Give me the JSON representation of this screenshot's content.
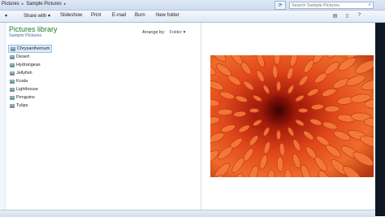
{
  "address": {
    "crumbs": [
      "Pictures",
      "Sample Pictures"
    ],
    "search_placeholder": "Search Sample Pictures"
  },
  "toolbar": {
    "items": [
      "Slideshow",
      "Print",
      "E-mail",
      "Burn",
      "New folder"
    ],
    "share": "Share with"
  },
  "library": {
    "title": "Pictures library",
    "subtitle": "Sample Pictures",
    "arrange_label": "Arrange by:",
    "arrange_value": "Folder"
  },
  "files": [
    "Chrysanthemum",
    "Desert",
    "Hydrangeas",
    "Jellyfish",
    "Koala",
    "Lighthouse",
    "Penguins",
    "Tulips"
  ],
  "colors": {
    "library_title": "#1c7a34",
    "selection": "#dbeafb",
    "photo_base": "#c23a10"
  }
}
